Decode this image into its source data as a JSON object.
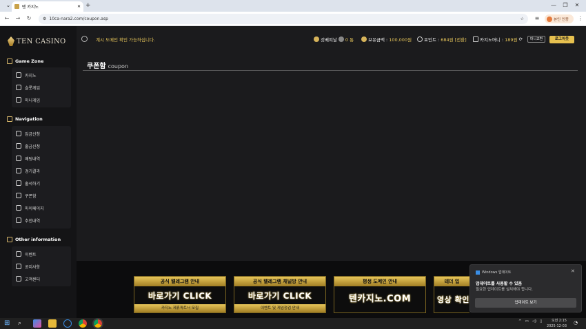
{
  "browser": {
    "tab_title": "텐 카지노",
    "url": "10ca-nara2.com/coupon.asp",
    "profile_label": "본인 인증"
  },
  "site": {
    "logo_text": "TEN CASINO",
    "notice": "계시 도메인 확인 가능하십니다.",
    "stats": {
      "member_label": "갓베피날",
      "member_value": "0 통",
      "balance_label": "보유금액 :",
      "balance_value": "100,000원",
      "point_label": "포인트 :",
      "point_value": "684원 [전환]",
      "casino_label": "카지노머니 :",
      "casino_value": "189원"
    },
    "mini_button": "머니교환",
    "logout": "로그아웃"
  },
  "sidebar": {
    "sections": [
      {
        "title": "Game Zone",
        "items": [
          "카지노",
          "슬롯게임",
          "미니게임"
        ]
      },
      {
        "title": "Navigation",
        "items": [
          "입금신청",
          "출금신청",
          "배팅내역",
          "경기결과",
          "출석하기",
          "쿠폰함",
          "마이페이지",
          "추천내역"
        ]
      },
      {
        "title": "Other information",
        "items": [
          "이벤트",
          "공지사항",
          "고객센터"
        ]
      }
    ]
  },
  "content": {
    "title": "쿠폰함",
    "subtitle": "coupon"
  },
  "banners": [
    {
      "top": "공식 텔레그램 안내",
      "main": "바로가기 CLICK",
      "sub": "카지노 제휴파트너 모집"
    },
    {
      "top": "공식 텔레그램 채널방 안내",
      "main": "바로가기 CLICK",
      "sub": "이벤트 및 게임정검 안내"
    },
    {
      "top": "평생 도메인 안내",
      "main": "텐카지노.COM",
      "sub": ""
    },
    {
      "top": "테더 입",
      "main": "영상 확인",
      "sub": ""
    }
  ],
  "toast": {
    "app": "Windows 업데이트",
    "title": "업데이트를 사용할 수 있음",
    "body": "필요한 업데이트를 설치해야 합니다.",
    "button": "업데이트 보기"
  },
  "taskbar": {
    "time": "오전 2:15",
    "date": "2025-12-03"
  }
}
